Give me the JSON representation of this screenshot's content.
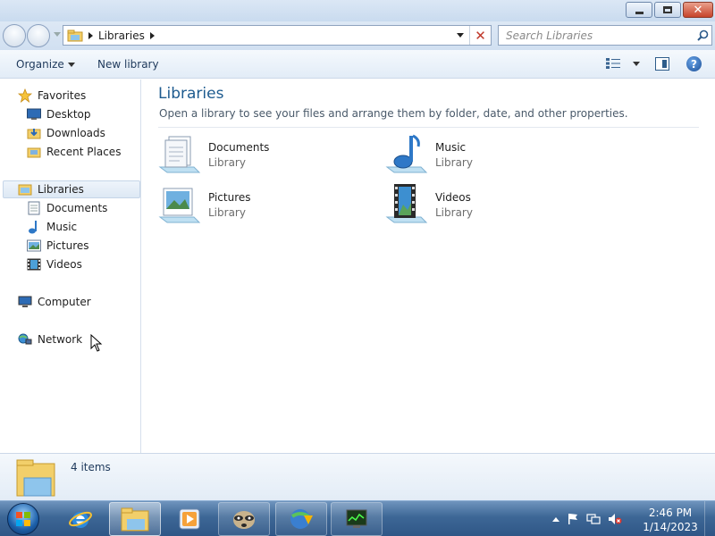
{
  "window": {
    "minimize_label": "Minimize",
    "maximize_label": "Restore",
    "close_label": "Close"
  },
  "address": {
    "path": "Libraries",
    "search_placeholder": "Search Libraries"
  },
  "toolbar": {
    "organize_label": "Organize",
    "new_library_label": "New library"
  },
  "navpane": {
    "favorites": "Favorites",
    "desktop": "Desktop",
    "downloads": "Downloads",
    "recent_places": "Recent Places",
    "libraries": "Libraries",
    "documents": "Documents",
    "music": "Music",
    "pictures": "Pictures",
    "videos": "Videos",
    "computer": "Computer",
    "network": "Network"
  },
  "content": {
    "title": "Libraries",
    "subtitle": "Open a library to see your files and arrange them by folder, date, and other properties.",
    "items": [
      {
        "name": "Documents",
        "type": "Library"
      },
      {
        "name": "Music",
        "type": "Library"
      },
      {
        "name": "Pictures",
        "type": "Library"
      },
      {
        "name": "Videos",
        "type": "Library"
      }
    ]
  },
  "details": {
    "count": "4 items"
  },
  "taskbar": {
    "time": "2:46 PM",
    "date": "1/14/2023"
  },
  "colors": {
    "title_blue": "#1e5b8f",
    "taskbar_blue": "#3d6796",
    "selection": "#dde8f4"
  }
}
